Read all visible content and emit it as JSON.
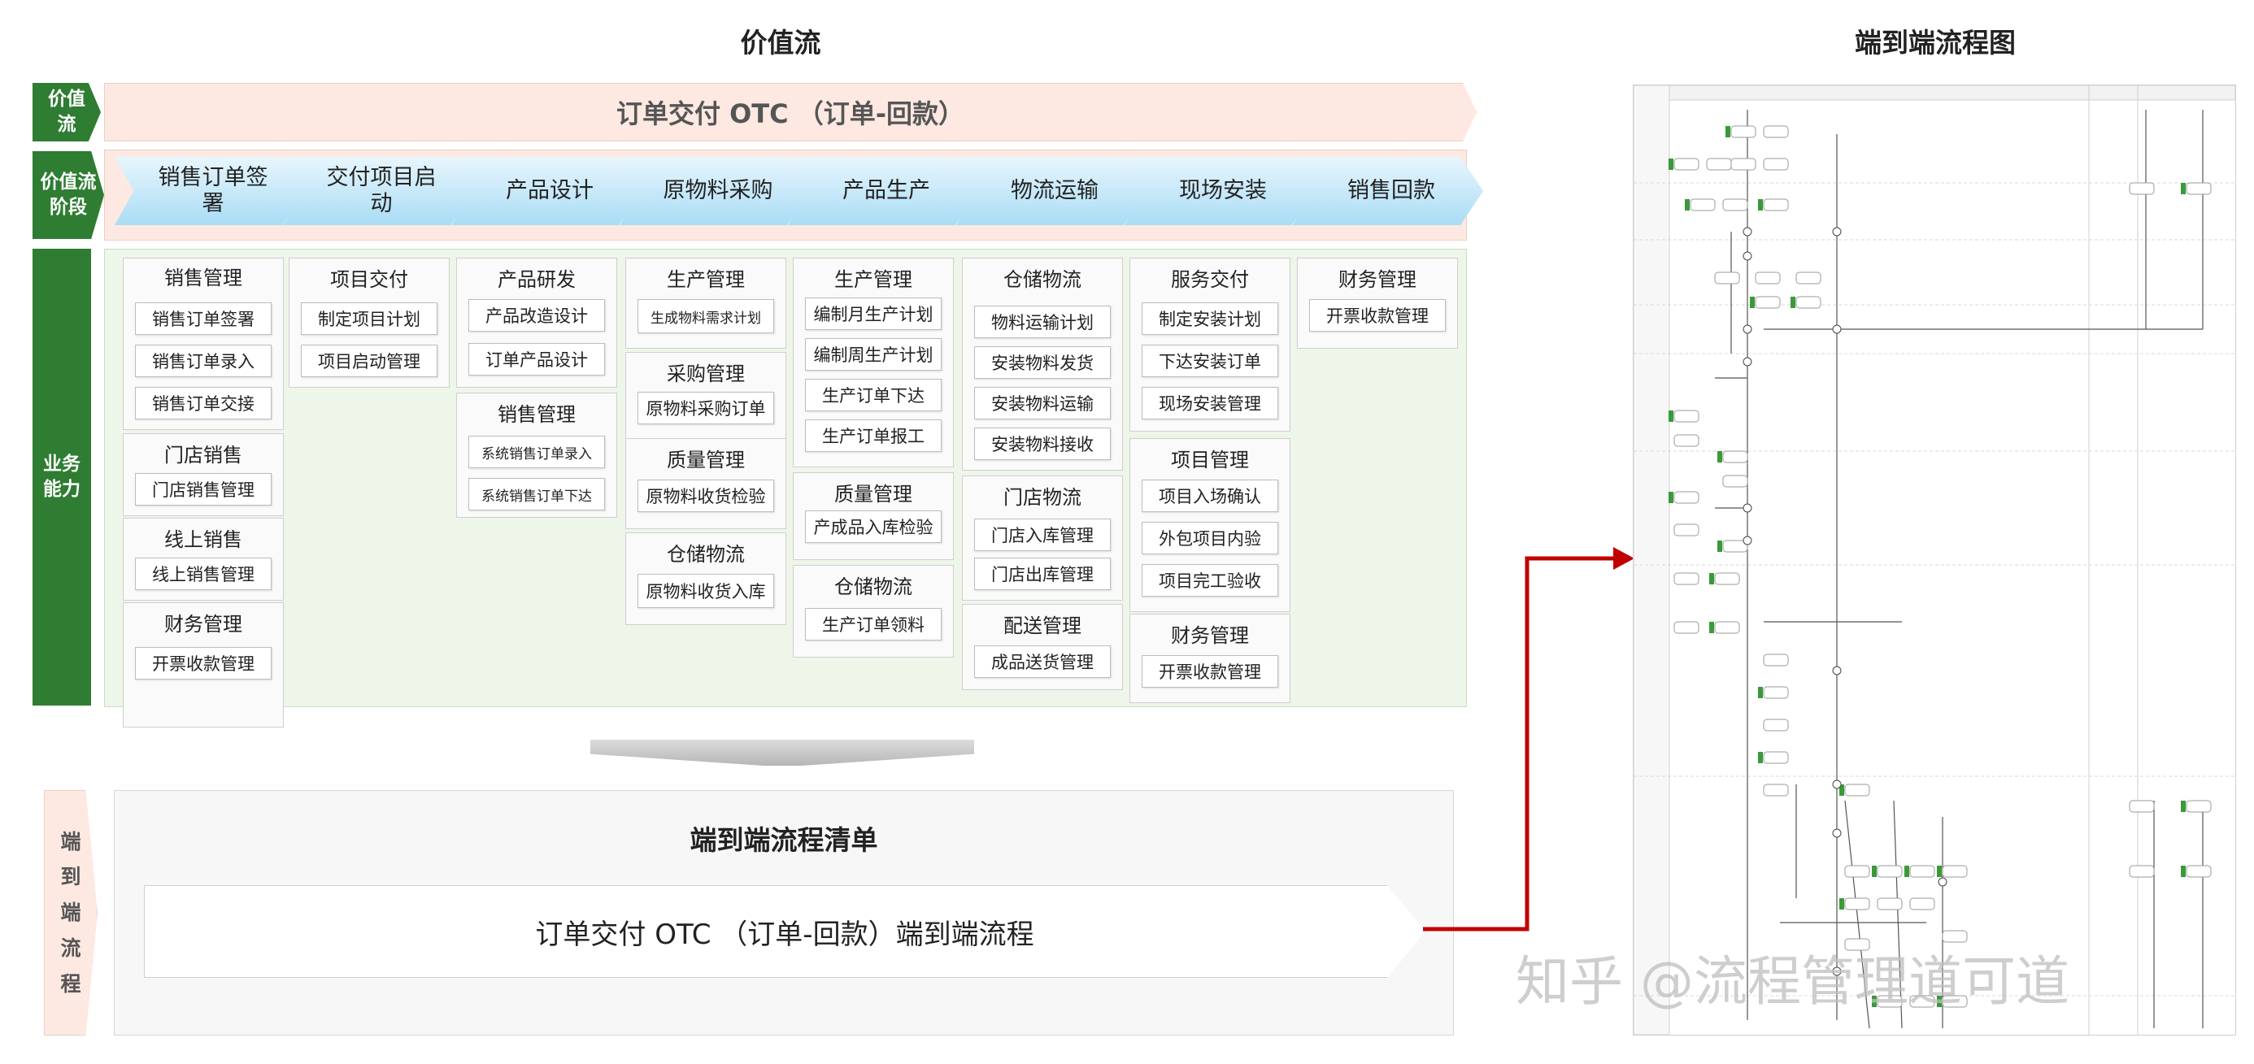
{
  "titles": {
    "value_stream": "价值流",
    "flowchart": "端到端流程图"
  },
  "side_labels": {
    "value_stream": "价值流",
    "stages": "价值流阶段",
    "capability": "业务能力"
  },
  "banner": "订单交付 OTC （订单-回款）",
  "stages": [
    "销售订单签署",
    "交付项目启动",
    "产品设计",
    "原物料采购",
    "产品生产",
    "物流运输",
    "现场安装",
    "销售回款"
  ],
  "capabilities": {
    "col1": [
      {
        "title": "销售管理",
        "items": [
          "销售订单签署",
          "销售订单录入",
          "销售订单交接"
        ]
      },
      {
        "title": "门店销售",
        "items": [
          "门店销售管理"
        ]
      },
      {
        "title": "线上销售",
        "items": [
          "线上销售管理"
        ]
      },
      {
        "title": "财务管理",
        "items": [
          "开票收款管理"
        ]
      }
    ],
    "col2": [
      {
        "title": "项目交付",
        "items": [
          "制定项目计划",
          "项目启动管理"
        ]
      }
    ],
    "col3": [
      {
        "title": "产品研发",
        "items": [
          "产品改造设计",
          "订单产品设计"
        ]
      },
      {
        "title": "销售管理",
        "items": [
          "系统销售订单录入",
          "系统销售订单下达"
        ]
      }
    ],
    "col4": [
      {
        "title": "生产管理",
        "items": [
          "生成物料需求计划"
        ]
      },
      {
        "title": "采购管理",
        "items": [
          "原物料采购订单"
        ]
      },
      {
        "title": "质量管理",
        "items": [
          "原物料收货检验"
        ]
      },
      {
        "title": "仓储物流",
        "items": [
          "原物料收货入库"
        ]
      }
    ],
    "col5": [
      {
        "title": "生产管理",
        "items": [
          "编制月生产计划",
          "编制周生产计划",
          "生产订单下达",
          "生产订单报工"
        ]
      },
      {
        "title": "质量管理",
        "items": [
          "产成品入库检验"
        ]
      },
      {
        "title": "仓储物流",
        "items": [
          "生产订单领料"
        ]
      }
    ],
    "col6": [
      {
        "title": "仓储物流",
        "items": [
          "物料运输计划",
          "安装物料发货",
          "安装物料运输",
          "安装物料接收"
        ]
      },
      {
        "title": "门店物流",
        "items": [
          "门店入库管理",
          "门店出库管理"
        ]
      },
      {
        "title": "配送管理",
        "items": [
          "成品送货管理"
        ]
      }
    ],
    "col7": [
      {
        "title": "服务交付",
        "items": [
          "制定安装计划",
          "下达安装订单",
          "现场安装管理"
        ]
      },
      {
        "title": "项目管理",
        "items": [
          "项目入场确认",
          "外包项目内验",
          "项目完工验收"
        ]
      },
      {
        "title": "财务管理",
        "items": [
          "开票收款管理"
        ]
      }
    ],
    "col8": [
      {
        "title": "财务管理",
        "items": [
          "开票收款管理"
        ]
      }
    ]
  },
  "e2e": {
    "side": [
      "端",
      "到",
      "端",
      "流",
      "程"
    ],
    "title": "端到端流程清单",
    "item": "订单交付 OTC （订单-回款）端到端流程"
  },
  "watermark": "知乎 @流程管理道可道",
  "colors": {
    "green": "#2e7d32",
    "peach": "#fde9e1",
    "blue": "#a9dcf5",
    "arrow_red": "#c00000",
    "flow_green": "#3a9a3a"
  }
}
